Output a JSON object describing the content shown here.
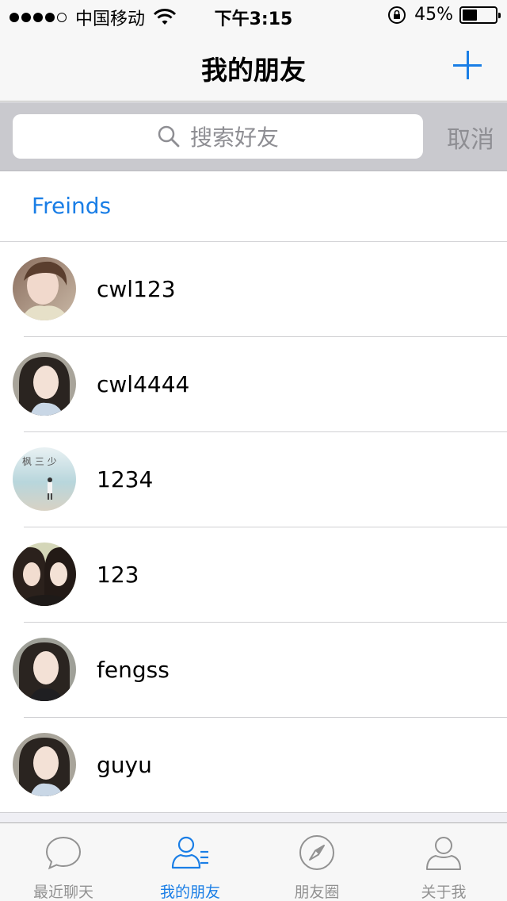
{
  "status_bar": {
    "carrier": "中国移动",
    "time": "下午3:15",
    "battery": "45%",
    "battery_level": 0.45
  },
  "nav": {
    "title": "我的朋友",
    "add_icon": "plus-icon"
  },
  "search": {
    "placeholder": "搜索好友",
    "cancel_label": "取消"
  },
  "section": {
    "title": "Freinds"
  },
  "friends": [
    {
      "name": "cwl123"
    },
    {
      "name": "cwl4444"
    },
    {
      "name": "1234"
    },
    {
      "name": "123"
    },
    {
      "name": "fengss"
    },
    {
      "name": "guyu"
    }
  ],
  "tabs": [
    {
      "label": "最近聊天",
      "icon": "chat-bubble-icon",
      "active": false
    },
    {
      "label": "我的朋友",
      "icon": "contacts-icon",
      "active": true
    },
    {
      "label": "朋友圈",
      "icon": "compass-icon",
      "active": false
    },
    {
      "label": "关于我",
      "icon": "person-icon",
      "active": false
    }
  ],
  "colors": {
    "accent": "#1a7ee6",
    "inactive": "#929292"
  }
}
